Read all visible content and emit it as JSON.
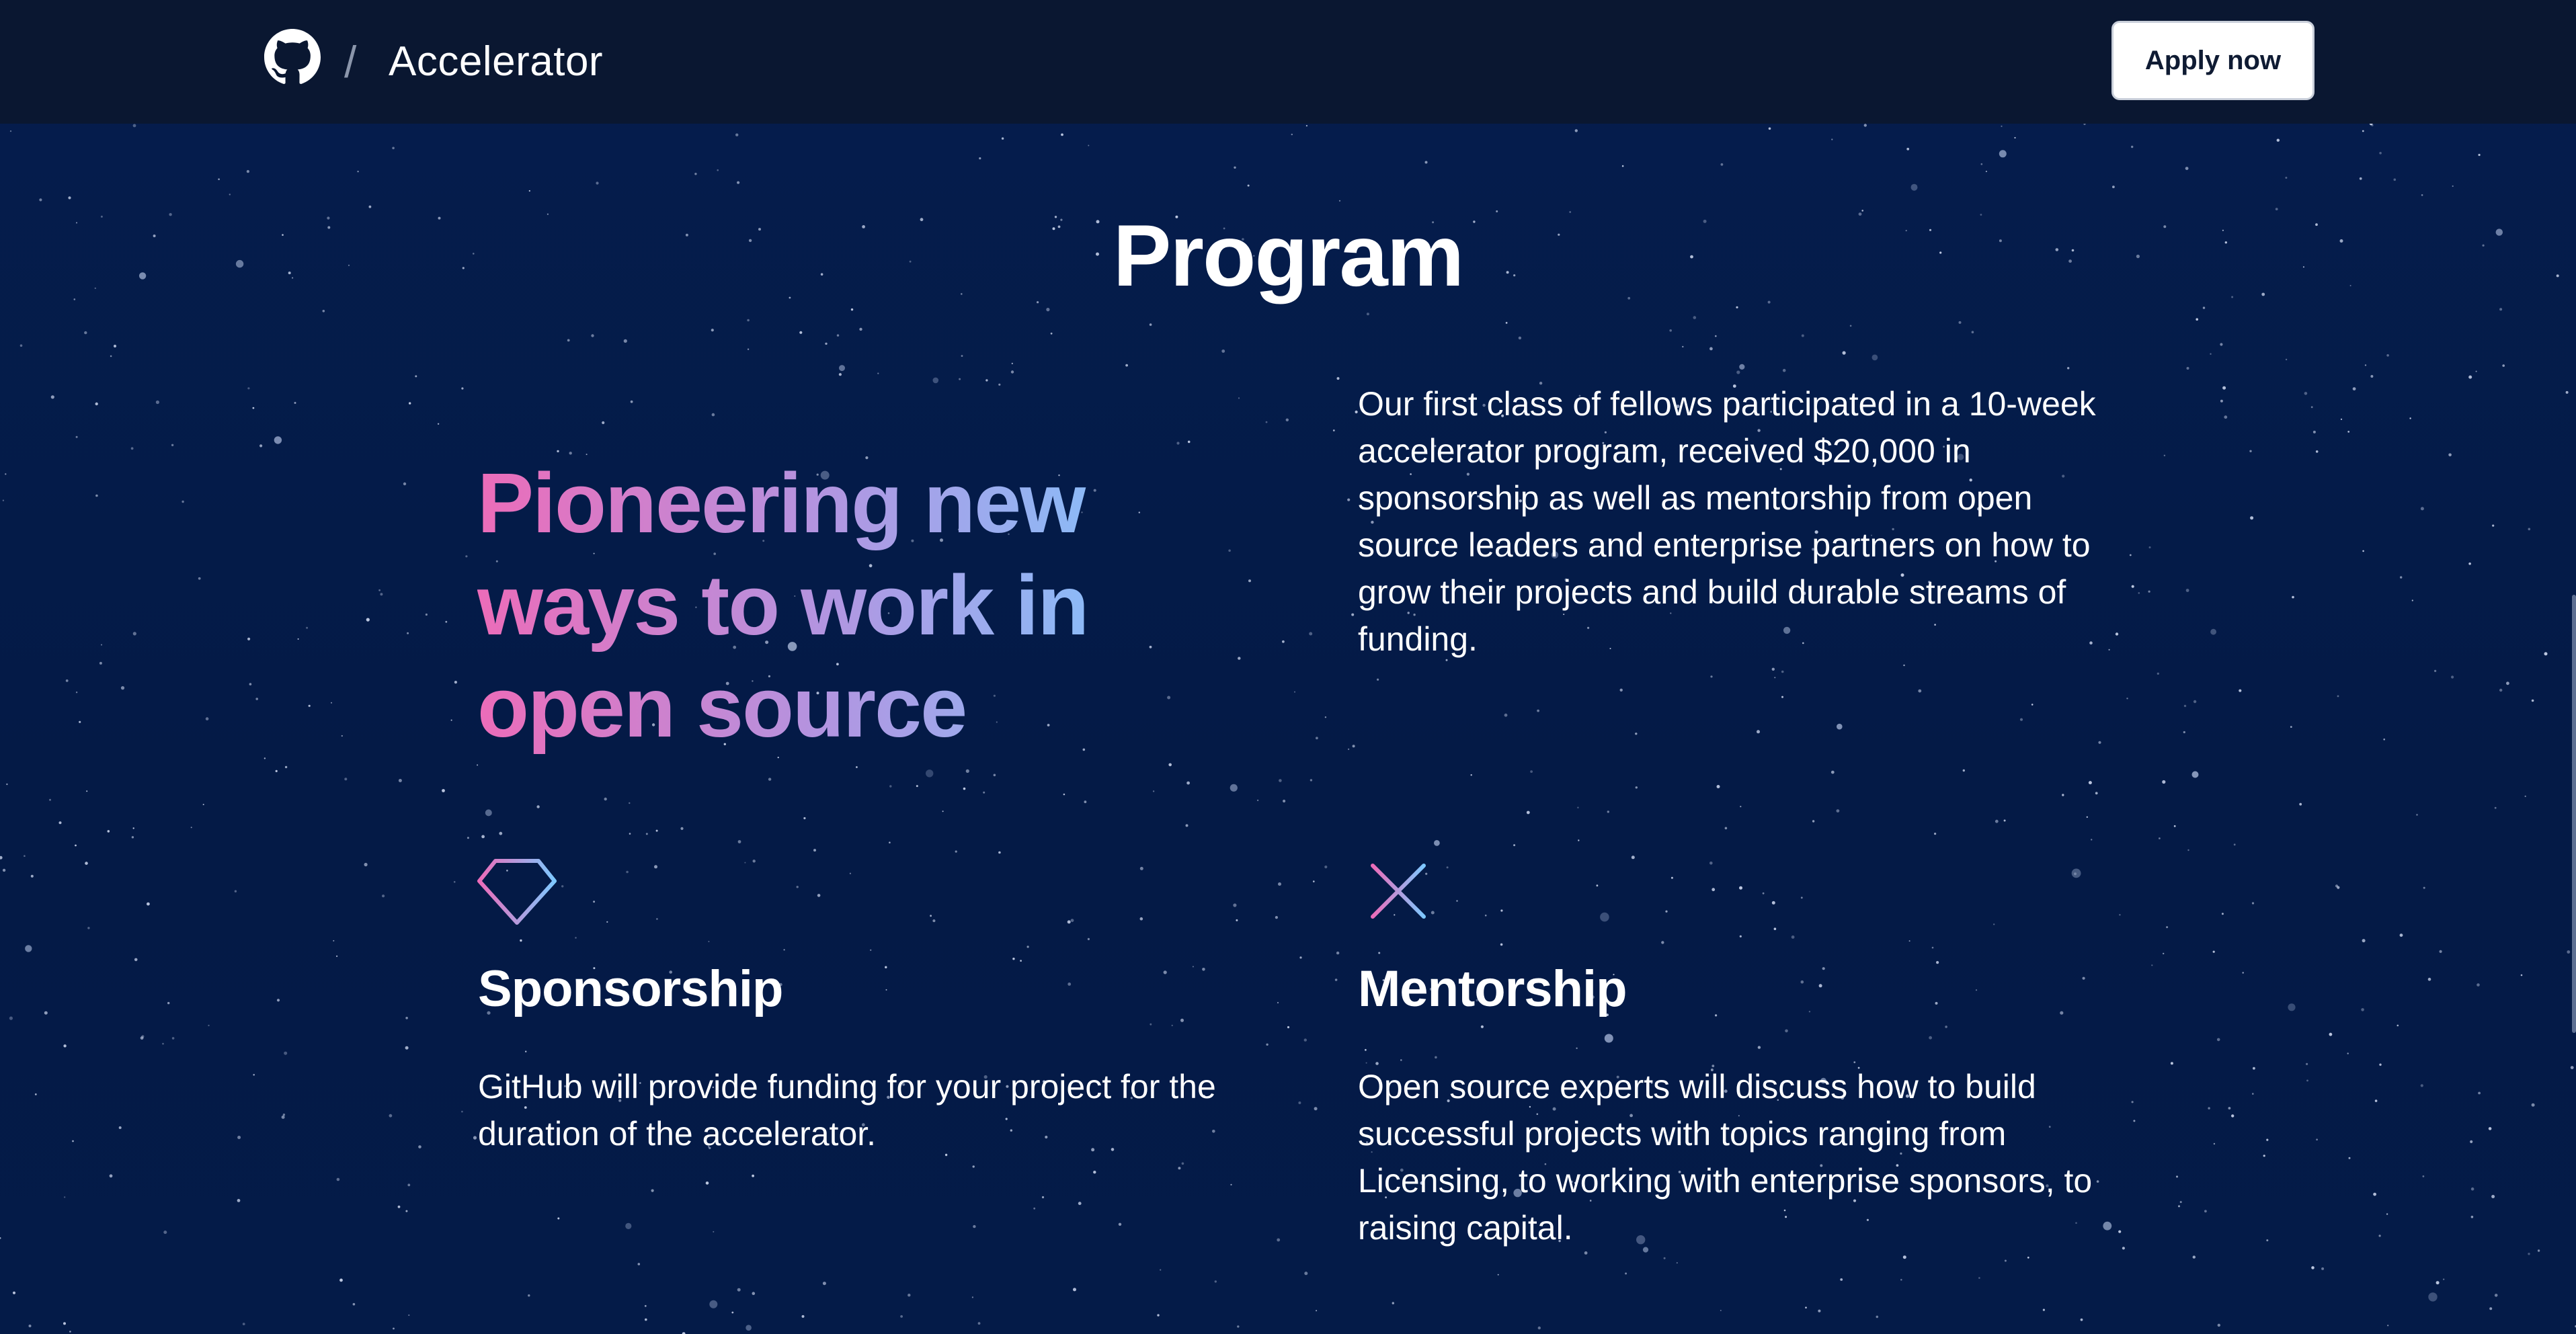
{
  "header": {
    "logo_icon": "github-octocat-icon",
    "separator": "/",
    "title": "Accelerator",
    "apply_label": "Apply now"
  },
  "section": {
    "title": "Program"
  },
  "hero": {
    "heading": "Pioneering new ways to work in open source",
    "description": "Our first class of fellows participated in a 10-week accelerator program, received $20,000 in sponsorship as well as mentorship from open source leaders and enterprise partners on how to grow their projects and build durable streams of funding."
  },
  "features": [
    {
      "icon": "diamond-icon",
      "title": "Sponsorship",
      "description": "GitHub will provide funding for your project for the duration of the accelerator."
    },
    {
      "icon": "sparkle-asterisk-icon",
      "title": "Mentorship",
      "description": "Open source experts will discuss how to build successful projects with topics ranging from Licensing, to working with enterprise sponsors, to raising capital."
    }
  ],
  "colors": {
    "background": "#041c4a",
    "header_background": "#0a1731",
    "gradient_pink": "#ec6cb9",
    "gradient_purple": "#b394e0",
    "gradient_blue": "#7ec8ff"
  }
}
